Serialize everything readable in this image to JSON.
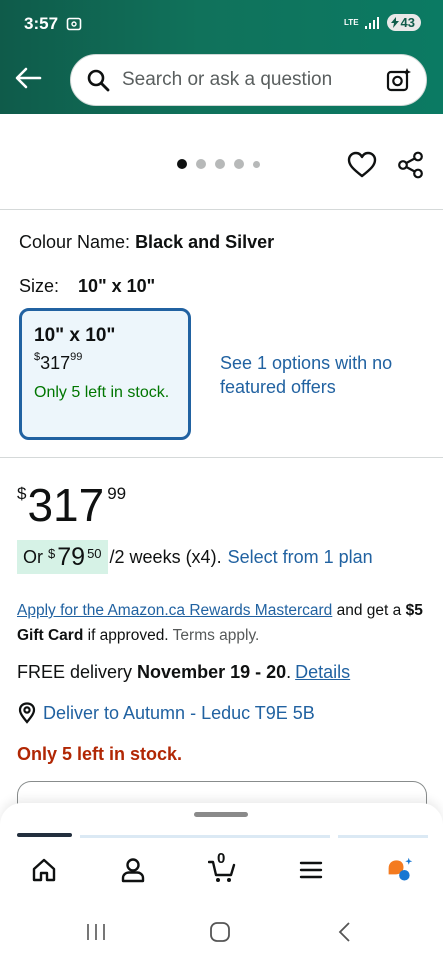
{
  "status_bar": {
    "time": "3:57",
    "network": "LTE",
    "battery": "43"
  },
  "header": {
    "search_placeholder": "Search or ask a question"
  },
  "gallery": {
    "dots_count": 5,
    "active_dot": 0
  },
  "product": {
    "colour_label": "Colour Name:",
    "colour_value": "Black and Silver",
    "size_label": "Size:",
    "size_value": "10\" x 10\"",
    "size_option": {
      "size": "10\" x 10\"",
      "price_currency": "$",
      "price_whole": "317",
      "price_cents": "99",
      "stock": "Only 5 left in stock."
    },
    "see_options": "See 1 options with no featured offers",
    "price": {
      "currency": "$",
      "whole": "317",
      "cents": "99"
    },
    "plan": {
      "prefix": "Or",
      "currency": "$",
      "whole": "79",
      "cents": "50",
      "period": "/2 weeks (x4).",
      "select_link": "Select from 1 plan"
    },
    "rewards": {
      "link": "Apply for the Amazon.ca Rewards Mastercard",
      "text_1": " and get a ",
      "gift": "$5 Gift Card",
      "text_2": " if approved. ",
      "terms": "Terms apply."
    },
    "delivery": {
      "prefix": "FREE delivery ",
      "dates": "November 19 - 20",
      "suffix": ".",
      "details_link": "Details"
    },
    "deliver_to": "Deliver to Autumn - Leduc T9E 5B",
    "stock_warning": "Only 5 left in stock."
  },
  "bottom_nav": {
    "cart_count": "0"
  },
  "colors": {
    "header_green": "#10725b",
    "link_blue": "#2162a1",
    "stock_green": "#007600",
    "warning_red": "#b12704",
    "selected_border": "#2162a1"
  }
}
